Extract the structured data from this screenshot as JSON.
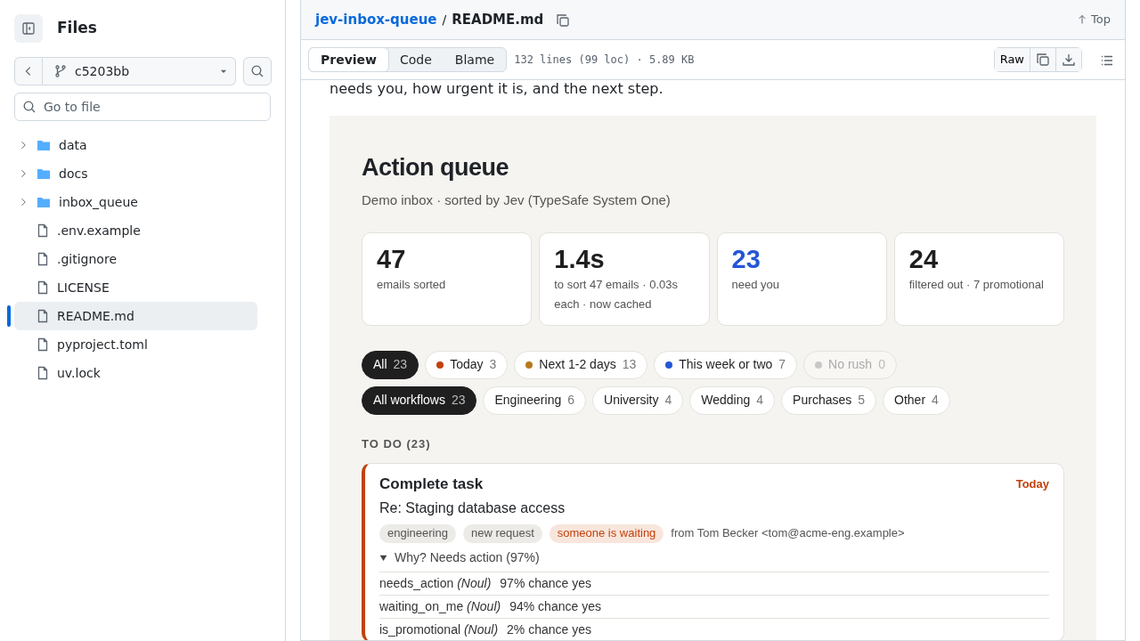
{
  "sidebar": {
    "title": "Files",
    "branch": "c5203bb",
    "search": {
      "placeholder": "Go to file"
    },
    "tree": [
      {
        "kind": "folder",
        "label": "data",
        "expanded": false,
        "selected": false
      },
      {
        "kind": "folder",
        "label": "docs",
        "expanded": false,
        "selected": false
      },
      {
        "kind": "folder",
        "label": "inbox_queue",
        "expanded": false,
        "selected": false
      },
      {
        "kind": "file",
        "label": ".env.example",
        "selected": false
      },
      {
        "kind": "file",
        "label": ".gitignore",
        "selected": false
      },
      {
        "kind": "file",
        "label": "LICENSE",
        "selected": false
      },
      {
        "kind": "file",
        "label": "README.md",
        "selected": true
      },
      {
        "kind": "file",
        "label": "pyproject.toml",
        "selected": false
      },
      {
        "kind": "file",
        "label": "uv.lock",
        "selected": false
      }
    ]
  },
  "breadcrumb": {
    "repo": "jev-inbox-queue",
    "separator": "/",
    "file": "README.md",
    "top": "Top"
  },
  "view_tabs": [
    {
      "label": "Preview",
      "selected": true
    },
    {
      "label": "Code",
      "selected": false
    },
    {
      "label": "Blame",
      "selected": false
    }
  ],
  "file_info": "132 lines (99 loc) · 5.89 KB",
  "raw_button": "Raw",
  "intro_text": "needs you, how urgent it is, and the next step.",
  "preview": {
    "title": "Action queue",
    "subtitle": "Demo inbox · sorted by Jev (TypeSafe System One)",
    "stats": [
      {
        "value": "47",
        "label": "emails sorted",
        "highlight": false
      },
      {
        "value": "1.4s",
        "label": "to sort 47 emails · 0.03s each · now cached",
        "highlight": false
      },
      {
        "value": "23",
        "label": "need you",
        "highlight": true
      },
      {
        "value": "24",
        "label": "filtered out · 7 promotional",
        "highlight": false
      }
    ],
    "urgency_filters": [
      {
        "label": "All",
        "count": "23",
        "selected": true,
        "disabled": false
      },
      {
        "label": "Today",
        "count": "3",
        "selected": false,
        "disabled": false,
        "color": "#c2410c"
      },
      {
        "label": "Next 1-2 days",
        "count": "13",
        "selected": false,
        "disabled": false,
        "color": "#b7791f"
      },
      {
        "label": "This week or two",
        "count": "7",
        "selected": false,
        "disabled": false,
        "color": "#2456d6"
      },
      {
        "label": "No rush",
        "count": "0",
        "selected": false,
        "disabled": true,
        "color": "#c8c8c8"
      }
    ],
    "workflow_filters": [
      {
        "label": "All workflows",
        "count": "23",
        "selected": true
      },
      {
        "label": "Engineering",
        "count": "6",
        "selected": false
      },
      {
        "label": "University",
        "count": "4",
        "selected": false
      },
      {
        "label": "Wedding",
        "count": "4",
        "selected": false
      },
      {
        "label": "Purchases",
        "count": "5",
        "selected": false
      },
      {
        "label": "Other",
        "count": "4",
        "selected": false
      }
    ],
    "section_heading": "TO DO (23)",
    "task": {
      "title": "Complete task",
      "due": "Today",
      "subject": "Re: Staging database access",
      "tags": [
        {
          "label": "engineering",
          "kind": "plain"
        },
        {
          "label": "new request",
          "kind": "plain"
        },
        {
          "label": "someone is waiting",
          "kind": "alert"
        }
      ],
      "sender": "from Tom Becker <tom@acme-eng.example>",
      "why": {
        "label": "Why? Needs action (97%)",
        "expanded": true,
        "rows": [
          {
            "signal": "needs_action *(Noul)*",
            "chance": "97% chance yes"
          },
          {
            "signal": "waiting_on_me *(Noul)*",
            "chance": "94% chance yes"
          },
          {
            "signal": "is_promotional *(Noul)*",
            "chance": "2% chance yes"
          }
        ]
      }
    }
  }
}
